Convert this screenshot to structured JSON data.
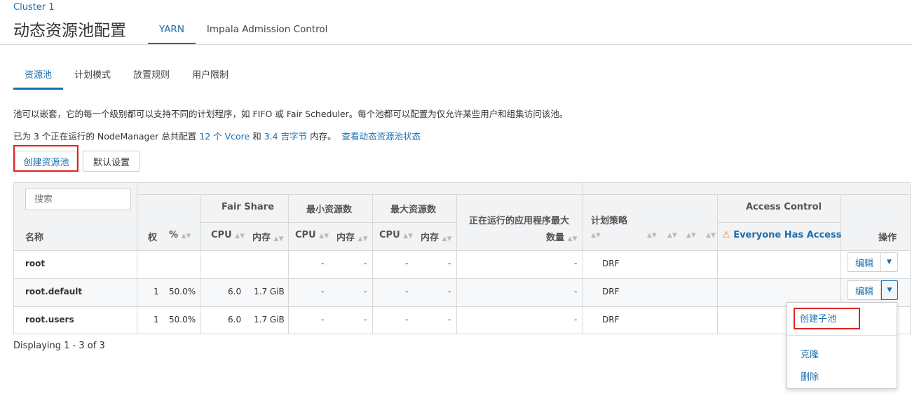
{
  "header": {
    "cluster": "Cluster 1",
    "title": "动态资源池配置",
    "tabs": [
      "YARN",
      "Impala Admission Control"
    ]
  },
  "subtabs": [
    "资源池",
    "计划模式",
    "放置规则",
    "用户限制"
  ],
  "description": "池可以嵌套，它的每一个级别都可以支持不同的计划程序，如 FIFO 或 Fair Scheduler。每个池都可以配置为仅允许某些用户和组集访问该池。",
  "summary": {
    "prefix": "已为 3 个正在运行的 NodeManager 总共配置",
    "vcore": "12 个 Vcore",
    "and": "和",
    "memory": "3.4 吉字节",
    "suffix": "内存。",
    "status_link": "查看动态资源池状态"
  },
  "buttons": {
    "create_pool": "创建资源池",
    "defaults": "默认设置"
  },
  "table": {
    "search_placeholder": "搜索",
    "headers": {
      "name": "名称",
      "weight": "权",
      "percent": "%",
      "fair_share": "Fair Share",
      "min_resources": "最小资源数",
      "max_resources": "最大资源数",
      "cpu": "CPU",
      "memory": "内存",
      "max_running_apps_line1": "正在运行的应用程序最大",
      "max_running_apps_line2": "数量",
      "scheduling_policy": "计划策略",
      "access_control": "Access Control",
      "everyone_access": "Everyone Has Access",
      "actions": "操作"
    },
    "rows": [
      {
        "name": "root",
        "weight": "",
        "percent": "",
        "fs_cpu": "",
        "fs_mem": "",
        "min_cpu": "-",
        "min_mem": "-",
        "max_cpu": "-",
        "max_mem": "-",
        "max_apps": "-",
        "policy": "DRF"
      },
      {
        "name": "root.default",
        "weight": "1",
        "percent": "50.0%",
        "fs_cpu": "6.0",
        "fs_mem": "1.7 GiB",
        "min_cpu": "-",
        "min_mem": "-",
        "max_cpu": "-",
        "max_mem": "-",
        "max_apps": "-",
        "policy": "DRF"
      },
      {
        "name": "root.users",
        "weight": "1",
        "percent": "50.0%",
        "fs_cpu": "6.0",
        "fs_mem": "1.7 GiB",
        "min_cpu": "-",
        "min_mem": "-",
        "max_cpu": "-",
        "max_mem": "-",
        "max_apps": "-",
        "policy": "DRF"
      }
    ],
    "edit_label": "编辑"
  },
  "dropdown": [
    "创建子池",
    "克隆",
    "删除"
  ],
  "footer": "Displaying 1 - 3 of 3"
}
